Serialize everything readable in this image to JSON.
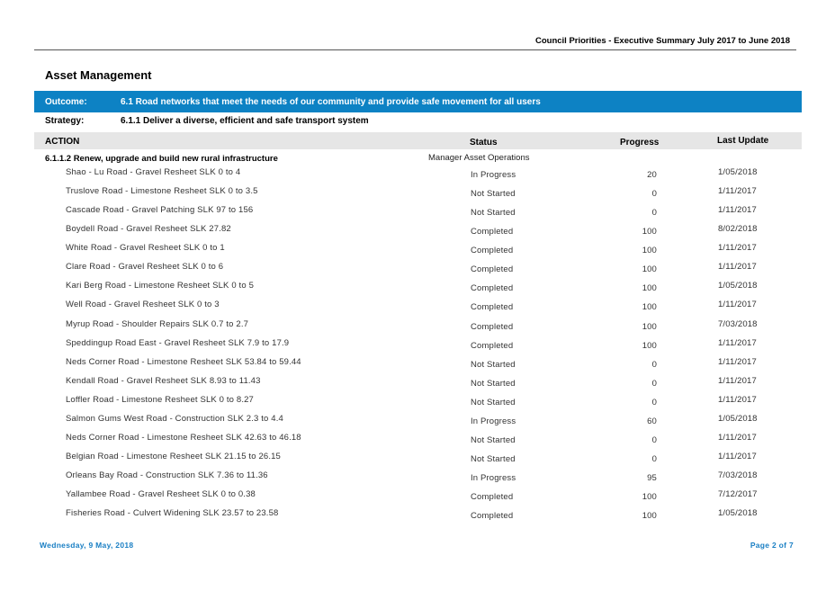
{
  "header": {
    "title": "Council Priorities - Executive Summary  July 2017 to June 2018"
  },
  "section": {
    "title": "Asset Management"
  },
  "outcome": {
    "label": "Outcome:",
    "text": "6.1  Road networks that meet the needs of our community and provide safe movement for all users"
  },
  "strategy": {
    "label": "Strategy:",
    "text": "6.1.1  Deliver a diverse, efficient and safe transport system"
  },
  "columns": {
    "action": "ACTION",
    "status": "Status",
    "progress": "Progress",
    "last_update": "Last Update"
  },
  "group": {
    "action": "6.1.1.2  Renew, upgrade and build new rural infrastructure",
    "responsible": "Manager Asset Operations"
  },
  "rows": [
    {
      "name": "Shao - Lu Road - Gravel Resheet SLK 0 to 4",
      "status": "In Progress",
      "progress": "20",
      "last_update": "1/05/2018"
    },
    {
      "name": "Truslove Road - Limestone Resheet SLK 0 to 3.5",
      "status": "Not Started",
      "progress": "0",
      "last_update": "1/11/2017"
    },
    {
      "name": "Cascade Road - Gravel Patching SLK 97 to 156",
      "status": "Not Started",
      "progress": "0",
      "last_update": "1/11/2017"
    },
    {
      "name": "Boydell Road - Gravel Resheet SLK 27.82",
      "status": "Completed",
      "progress": "100",
      "last_update": "8/02/2018"
    },
    {
      "name": "White Road - Gravel Resheet SLK 0 to 1",
      "status": "Completed",
      "progress": "100",
      "last_update": "1/11/2017"
    },
    {
      "name": "Clare Road - Gravel Resheet SLK 0 to 6",
      "status": "Completed",
      "progress": "100",
      "last_update": "1/11/2017"
    },
    {
      "name": "Kari Berg Road - Limestone Resheet SLK 0 to 5",
      "status": "Completed",
      "progress": "100",
      "last_update": "1/05/2018"
    },
    {
      "name": "Well Road - Gravel Resheet SLK 0 to 3",
      "status": "Completed",
      "progress": "100",
      "last_update": "1/11/2017"
    },
    {
      "name": "Myrup Road - Shoulder Repairs SLK 0.7 to 2.7",
      "status": "Completed",
      "progress": "100",
      "last_update": "7/03/2018"
    },
    {
      "name": "Speddingup Road East - Gravel Resheet SLK 7.9 to 17.9",
      "status": "Completed",
      "progress": "100",
      "last_update": "1/11/2017"
    },
    {
      "name": "Neds Corner Road - Limestone Resheet SLK 53.84 to 59.44",
      "status": "Not Started",
      "progress": "0",
      "last_update": "1/11/2017"
    },
    {
      "name": "Kendall Road - Gravel Resheet SLK 8.93 to 11.43",
      "status": "Not Started",
      "progress": "0",
      "last_update": "1/11/2017"
    },
    {
      "name": "Loffler Road - Limestone Resheet SLK 0 to 8.27",
      "status": "Not Started",
      "progress": "0",
      "last_update": "1/11/2017"
    },
    {
      "name": "Salmon Gums West Road - Construction SLK 2.3 to 4.4",
      "status": "In Progress",
      "progress": "60",
      "last_update": "1/05/2018"
    },
    {
      "name": "Neds Corner Road - Limestone Resheet SLK 42.63 to 46.18",
      "status": "Not Started",
      "progress": "0",
      "last_update": "1/11/2017"
    },
    {
      "name": "Belgian Road - Limestone Resheet SLK 21.15 to 26.15",
      "status": "Not Started",
      "progress": "0",
      "last_update": "1/11/2017"
    },
    {
      "name": "Orleans Bay Road - Construction SLK 7.36 to 11.36",
      "status": "In Progress",
      "progress": "95",
      "last_update": "7/03/2018"
    },
    {
      "name": "Yallambee Road - Gravel Resheet SLK 0 to 0.38",
      "status": "Completed",
      "progress": "100",
      "last_update": "7/12/2017"
    },
    {
      "name": "Fisheries Road - Culvert Widening SLK 23.57 to 23.58",
      "status": "Completed",
      "progress": "100",
      "last_update": "1/05/2018"
    }
  ],
  "footer": {
    "date": "Wednesday, 9 May, 2018",
    "page": "Page 2 of 7"
  }
}
